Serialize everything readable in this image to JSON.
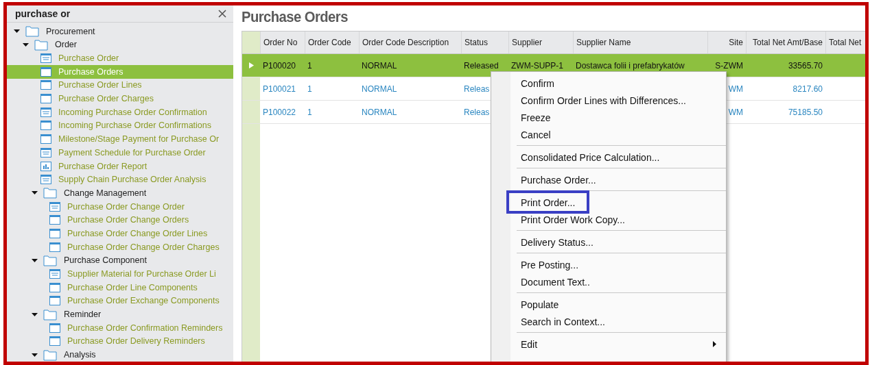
{
  "navigator": {
    "search": {
      "value": "purchase or"
    },
    "tree": [
      {
        "label": "Procurement",
        "kind": "folder",
        "expanded": true,
        "selected": false,
        "children": [
          {
            "label": "Order",
            "kind": "folder",
            "expanded": true,
            "selected": false,
            "children": [
              {
                "label": "Purchase Order",
                "kind": "form",
                "selected": false
              },
              {
                "label": "Purchase Orders",
                "kind": "list",
                "selected": true
              },
              {
                "label": "Purchase Order Lines",
                "kind": "list",
                "selected": false
              },
              {
                "label": "Purchase Order Charges",
                "kind": "list",
                "selected": false
              },
              {
                "label": "Incoming Purchase Order Confirmation",
                "kind": "form",
                "selected": false
              },
              {
                "label": "Incoming Purchase Order Confirmations",
                "kind": "list",
                "selected": false
              },
              {
                "label": "Milestone/Stage Payment for Purchase Or",
                "kind": "list",
                "selected": false
              },
              {
                "label": "Payment Schedule for Purchase Order",
                "kind": "form",
                "selected": false
              },
              {
                "label": "Purchase Order Report",
                "kind": "report",
                "selected": false
              },
              {
                "label": "Supply Chain Purchase Order Analysis",
                "kind": "form",
                "selected": false
              },
              {
                "label": "Change Management",
                "kind": "folder",
                "expanded": true,
                "selected": false,
                "children": [
                  {
                    "label": "Purchase Order Change Order",
                    "kind": "form",
                    "selected": false
                  },
                  {
                    "label": "Purchase Order Change Orders",
                    "kind": "list",
                    "selected": false
                  },
                  {
                    "label": "Purchase Order Change Order Lines",
                    "kind": "list",
                    "selected": false
                  },
                  {
                    "label": "Purchase Order Change Order Charges",
                    "kind": "list",
                    "selected": false
                  }
                ]
              },
              {
                "label": "Purchase Component",
                "kind": "folder",
                "expanded": true,
                "selected": false,
                "children": [
                  {
                    "label": "Supplier Material for Purchase Order Li",
                    "kind": "form",
                    "selected": false
                  },
                  {
                    "label": "Purchase Order Line Components",
                    "kind": "list",
                    "selected": false
                  },
                  {
                    "label": "Purchase Order Exchange Components",
                    "kind": "list",
                    "selected": false
                  }
                ]
              },
              {
                "label": "Reminder",
                "kind": "folder",
                "expanded": true,
                "selected": false,
                "children": [
                  {
                    "label": "Purchase Order Confirmation Reminders",
                    "kind": "list",
                    "selected": false
                  },
                  {
                    "label": "Purchase Order Delivery Reminders",
                    "kind": "list",
                    "selected": false
                  }
                ]
              },
              {
                "label": "Analysis",
                "kind": "folder",
                "expanded": true,
                "selected": false
              }
            ]
          }
        ]
      }
    ]
  },
  "page": {
    "title": "Purchase Orders",
    "table": {
      "columns": [
        "Order No",
        "Order Code",
        "Order Code Description",
        "Status",
        "Supplier",
        "Supplier Name",
        "Site",
        "Total Net Amt/Base",
        "Total Net"
      ],
      "rows": [
        {
          "selected": true,
          "cells": [
            "P100020",
            "1",
            "NORMAL",
            "Released",
            "ZWM-SUPP-1",
            "Dostawca folii i prefabrykatów",
            "S-ZWM",
            "33565.70",
            null
          ]
        },
        {
          "selected": false,
          "cells": [
            "P100021",
            "1",
            "NORMAL",
            "Releas",
            null,
            null,
            "WM",
            "8217.60",
            null
          ]
        },
        {
          "selected": false,
          "cells": [
            "P100022",
            "1",
            "NORMAL",
            "Releas",
            null,
            null,
            "WM",
            "75185.50",
            null
          ]
        }
      ]
    }
  },
  "context_menu": {
    "items": [
      {
        "kind": "item",
        "label": "Confirm",
        "highlighted": false
      },
      {
        "kind": "item",
        "label": "Confirm Order Lines with Differences...",
        "highlighted": false
      },
      {
        "kind": "item",
        "label": "Freeze",
        "highlighted": false
      },
      {
        "kind": "item",
        "label": "Cancel",
        "highlighted": false
      },
      {
        "kind": "separator"
      },
      {
        "kind": "item",
        "label": "Consolidated Price Calculation...",
        "highlighted": false
      },
      {
        "kind": "separator"
      },
      {
        "kind": "item",
        "label": "Purchase Order...",
        "highlighted": false
      },
      {
        "kind": "separator"
      },
      {
        "kind": "item",
        "label": "Print Order...",
        "highlighted": true
      },
      {
        "kind": "item",
        "label": "Print Order Work Copy...",
        "highlighted": false
      },
      {
        "kind": "separator"
      },
      {
        "kind": "item",
        "label": "Delivery Status...",
        "highlighted": false
      },
      {
        "kind": "separator"
      },
      {
        "kind": "item",
        "label": "Pre Posting...",
        "highlighted": false
      },
      {
        "kind": "item",
        "label": "Document Text..",
        "highlighted": false
      },
      {
        "kind": "separator"
      },
      {
        "kind": "item",
        "label": "Populate",
        "highlighted": false
      },
      {
        "kind": "item",
        "label": "Search in Context...",
        "highlighted": false
      },
      {
        "kind": "separator"
      },
      {
        "kind": "submenu",
        "label": "Edit",
        "highlighted": false
      }
    ]
  }
}
